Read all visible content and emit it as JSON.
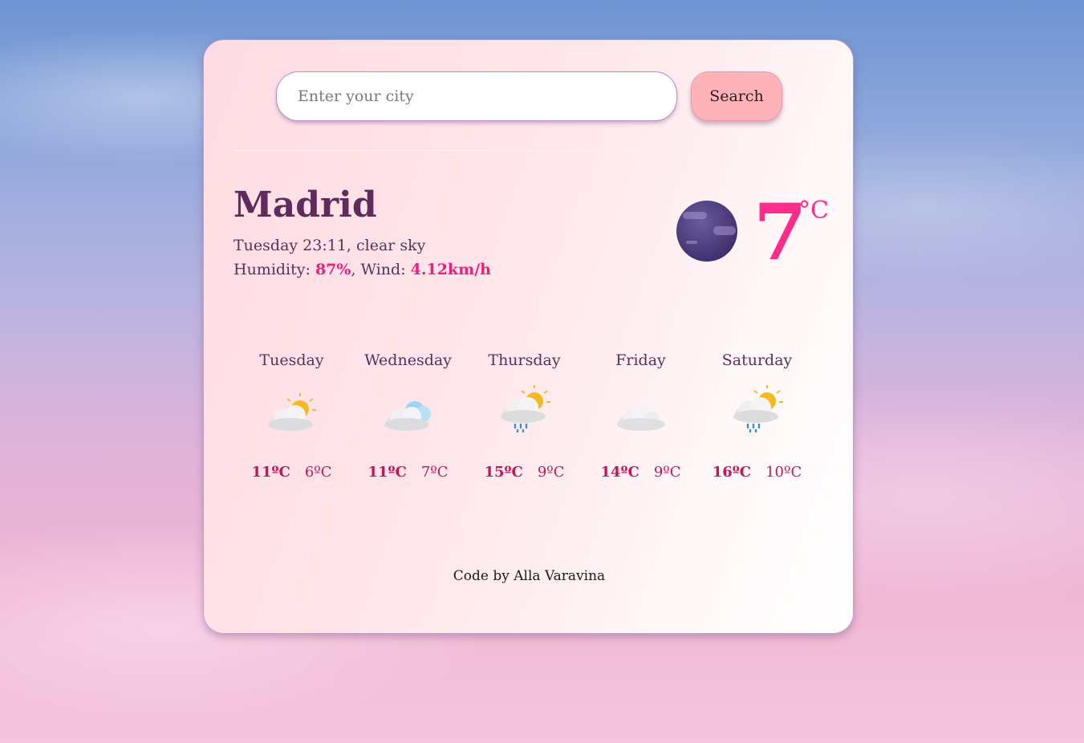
{
  "search": {
    "placeholder": "Enter your city",
    "button_label": "Search"
  },
  "current": {
    "city": "Madrid",
    "datetime_desc": "Tuesday 23:11, clear sky",
    "humidity_label": "Humidity: ",
    "humidity": "87%",
    "wind_label": ", Wind: ",
    "wind": "4.12km/h",
    "temperature": "7",
    "unit": "°C",
    "icon": "clear-night-moon-icon"
  },
  "forecast": [
    {
      "day": "Tuesday",
      "max": "11ºC",
      "min": "6ºC",
      "icon": "partly-cloudy-icon"
    },
    {
      "day": "Wednesday",
      "max": "11ºC",
      "min": "7ºC",
      "icon": "cloudy-icon"
    },
    {
      "day": "Thursday",
      "max": "15ºC",
      "min": "9ºC",
      "icon": "sun-rain-icon"
    },
    {
      "day": "Friday",
      "max": "14ºC",
      "min": "9ºC",
      "icon": "overcast-icon"
    },
    {
      "day": "Saturday",
      "max": "16ºC",
      "min": "10ºC",
      "icon": "sun-rain-icon"
    }
  ],
  "footer": "Code by Alla Varavina"
}
